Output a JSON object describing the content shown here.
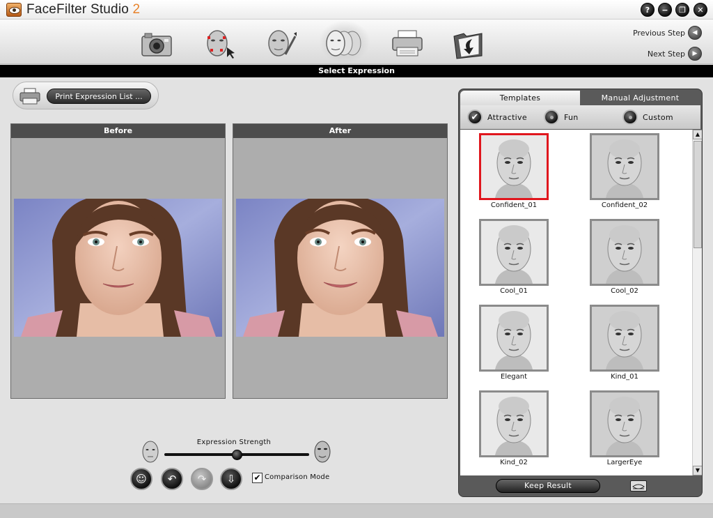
{
  "app": {
    "title_main": "FaceFilter Studio",
    "title_version": "2"
  },
  "window_controls": {
    "help": "?",
    "minimize": "−",
    "restore": "❐",
    "close": "✕"
  },
  "toolbar": {
    "steps": [
      {
        "name": "open-photo",
        "icon": "camera-icon"
      },
      {
        "name": "mark-features",
        "icon": "face-markers-icon"
      },
      {
        "name": "retouch",
        "icon": "face-brush-icon"
      },
      {
        "name": "select-expression",
        "icon": "faces-icon",
        "active": true
      },
      {
        "name": "print",
        "icon": "printer-icon"
      },
      {
        "name": "save",
        "icon": "folder-save-icon"
      }
    ],
    "previous_step": "Previous Step",
    "next_step": "Next Step"
  },
  "section": {
    "title": "Select Expression"
  },
  "print_list": {
    "label": "Print Expression List ..."
  },
  "before_panel": {
    "title": "Before"
  },
  "after_panel": {
    "title": "After"
  },
  "strength": {
    "label": "Expression Strength",
    "value_fraction": 0.5
  },
  "comparison": {
    "label": "Comparison Mode",
    "checked": true,
    "mark": "✔"
  },
  "right_panel": {
    "tabs": {
      "templates": "Templates",
      "manual": "Manual Adjustment"
    },
    "categories": [
      {
        "label": "Attractive",
        "selected": true
      },
      {
        "label": "Fun",
        "selected": false
      },
      {
        "label": "Custom",
        "selected": false
      }
    ],
    "templates": [
      {
        "label": "Confident_01",
        "selected": true
      },
      {
        "label": "Confident_02",
        "selected": false
      },
      {
        "label": "Cool_01",
        "selected": false
      },
      {
        "label": "Cool_02",
        "selected": false
      },
      {
        "label": "Elegant",
        "selected": false
      },
      {
        "label": "Kind_01",
        "selected": false
      },
      {
        "label": "Kind_02",
        "selected": false
      },
      {
        "label": "LargerEye",
        "selected": false
      }
    ],
    "keep_result": "Keep Result"
  },
  "colors": {
    "accent": "#e8822a",
    "selection": "#e0161d",
    "header": "#000000"
  }
}
